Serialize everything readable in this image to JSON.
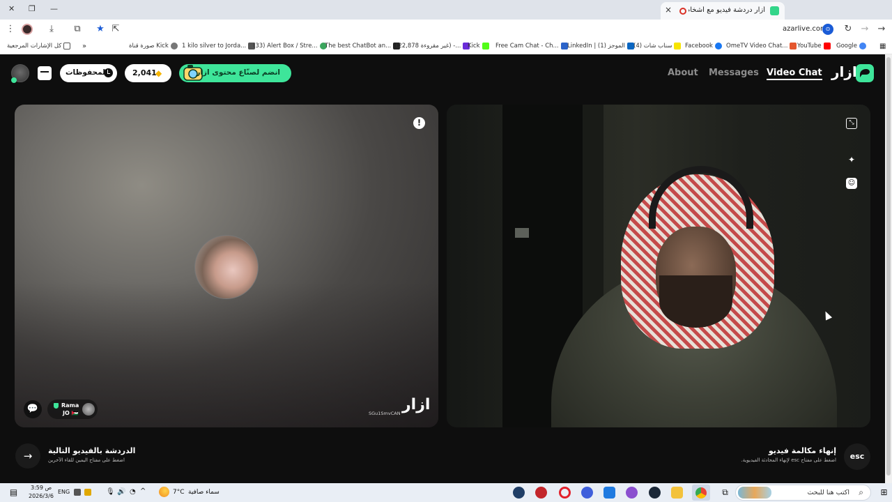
{
  "browser": {
    "tab_title": "أزار دردشة فيديو مع أشخاص",
    "tab_close": "×",
    "new_tab": "+",
    "url": "azarlive.com",
    "window": {
      "minimize": "—",
      "restore": "❐",
      "close": "✕"
    }
  },
  "bookmarks": {
    "all_bookmarks": "كل الإشارات المرجعية",
    "items": [
      {
        "label": "صورة قناة Kick",
        "color": "#777777"
      },
      {
        "label": "1 kilo silver to Jorda...",
        "color": "#555555"
      },
      {
        "label": "(33) Alert Box / Stre...",
        "color": "#3ba55d"
      },
      {
        "label": "The best ChatBot an...",
        "color": "#222222"
      },
      {
        "label": "(22,878 غير مقروءة) -...",
        "color": "#6a2bd9"
      },
      {
        "label": "Kick",
        "color": "#53fc18"
      },
      {
        "label": "Free Cam Chat - Ch...",
        "color": "#2b63c9"
      },
      {
        "label": "LinkedIn | (1) الموجز",
        "color": "#0a66c2"
      },
      {
        "label": "(4) سناب شات",
        "color": "#f7e400"
      },
      {
        "label": "Facebook",
        "color": "#1877f2"
      },
      {
        "label": "OmeTV Video Chat...",
        "color": "#e4572e"
      },
      {
        "label": "YouTube",
        "color": "#ff0000"
      },
      {
        "label": "Google",
        "color": "#4285f4"
      }
    ]
  },
  "header": {
    "logo": "ازار",
    "nav": [
      "About",
      "Messages",
      "Video Chat"
    ],
    "join_creators": "انضم لصنّاع محتوى ازار",
    "gems": "2,041",
    "saved": "المحفوظات"
  },
  "remote": {
    "peer_name": "Rama",
    "peer_country": "JO 🇯🇴",
    "watermark_id": "SGu1SmvCAN",
    "watermark_logo": "ازار",
    "report_icon": "!"
  },
  "footer": {
    "next_title": "الدردشة بالفيديو التالية",
    "next_hint": "اضغط على مفتاح اليمين للقاء الآخرين",
    "end_title": "إنهاء مكالمة فيديو",
    "end_hint": "اضغط على مفتاح esc لإنهاء المحادثة الفيديوية.",
    "esc_label": "esc"
  },
  "taskbar": {
    "time": "3:59 ص",
    "date": "2026/3/6",
    "lang": "ENG",
    "temp": "7°C",
    "weather": "سماء صافية",
    "search_placeholder": "اكتب هنا للبحث"
  }
}
